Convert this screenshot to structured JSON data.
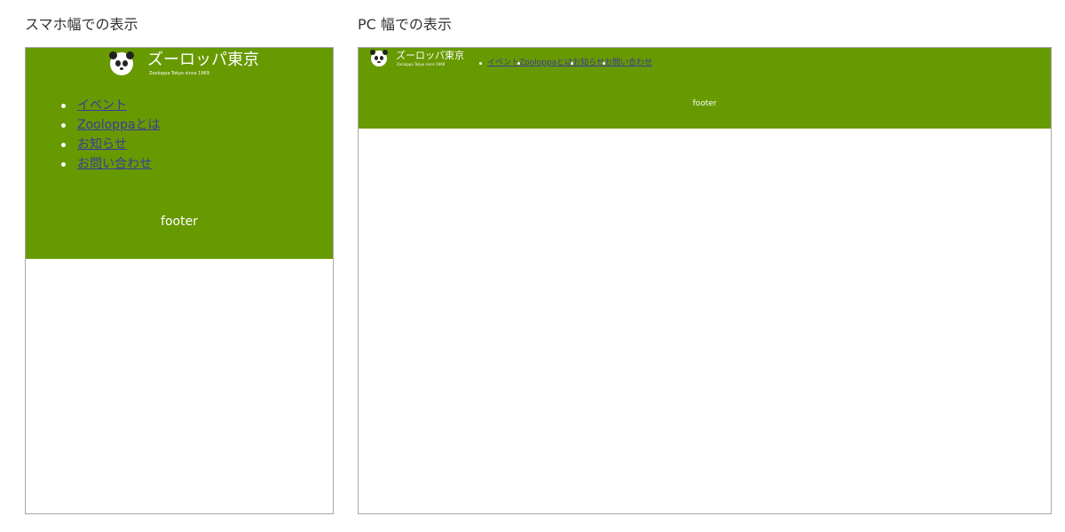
{
  "captions": {
    "sp": "スマホ幅での表示",
    "pc": "PC 幅での表示"
  },
  "site": {
    "title": "ズーロッパ東京",
    "subtitle": "Zooloppa Tokyo since 1969"
  },
  "nav": {
    "items": [
      {
        "label": "イベント"
      },
      {
        "label": "Zooloppaとは"
      },
      {
        "label": "お知らせ"
      },
      {
        "label": "お問い合わせ"
      }
    ]
  },
  "footer": {
    "text": "footer"
  },
  "colors": {
    "header_green": "#679900",
    "link": "#3b3b9a",
    "frame_border": "#a8a8a8"
  },
  "icons": {
    "logo": "panda-icon"
  }
}
